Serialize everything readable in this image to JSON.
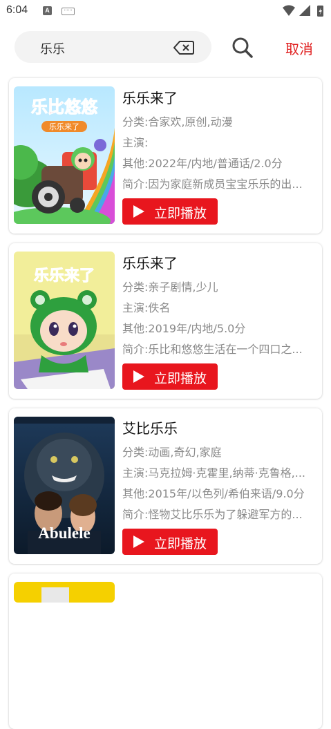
{
  "status": {
    "time": "6:04",
    "notif_a": "A"
  },
  "search": {
    "query": "乐乐",
    "cancel_label": "取消"
  },
  "results": [
    {
      "title": "乐乐来了",
      "category": "分类:合家欢,原创,动漫",
      "cast": "主演:",
      "other": "其他:2022年/内地/普通话/2.0分",
      "intro": "简介:因为家庭新成员宝宝乐乐的出...",
      "play_label": "立即播放",
      "poster": "cartoon-train-poster"
    },
    {
      "title": "乐乐来了",
      "category": "分类:亲子剧情,少儿",
      "cast": "主演:佚名",
      "other": "其他:2019年/内地/5.0分",
      "intro": "简介:乐比和悠悠生活在一个四口之...",
      "play_label": "立即播放",
      "poster": "cartoon-frog-hood-poster"
    },
    {
      "title": "艾比乐乐",
      "category": "分类:动画,奇幻,家庭",
      "cast": "主演:马克拉姆·克霍里,纳蒂·克鲁格,...",
      "other": "其他:2015年/以色列/希伯来语/9.0分",
      "intro": "简介:怪物艾比乐乐为了躲避军方的...",
      "play_label": "立即播放",
      "poster": "abulele-monster-poster"
    }
  ],
  "poster_texts": {
    "abulele_title": "Abulele",
    "lebi_youyou_logo": "乐比悠悠",
    "lele_sub": "乐乐来了",
    "lele_logo": "乐乐来了"
  },
  "colors": {
    "accent": "#e8161e",
    "cancel": "#e02020",
    "meta_text": "#8a8a8a"
  }
}
